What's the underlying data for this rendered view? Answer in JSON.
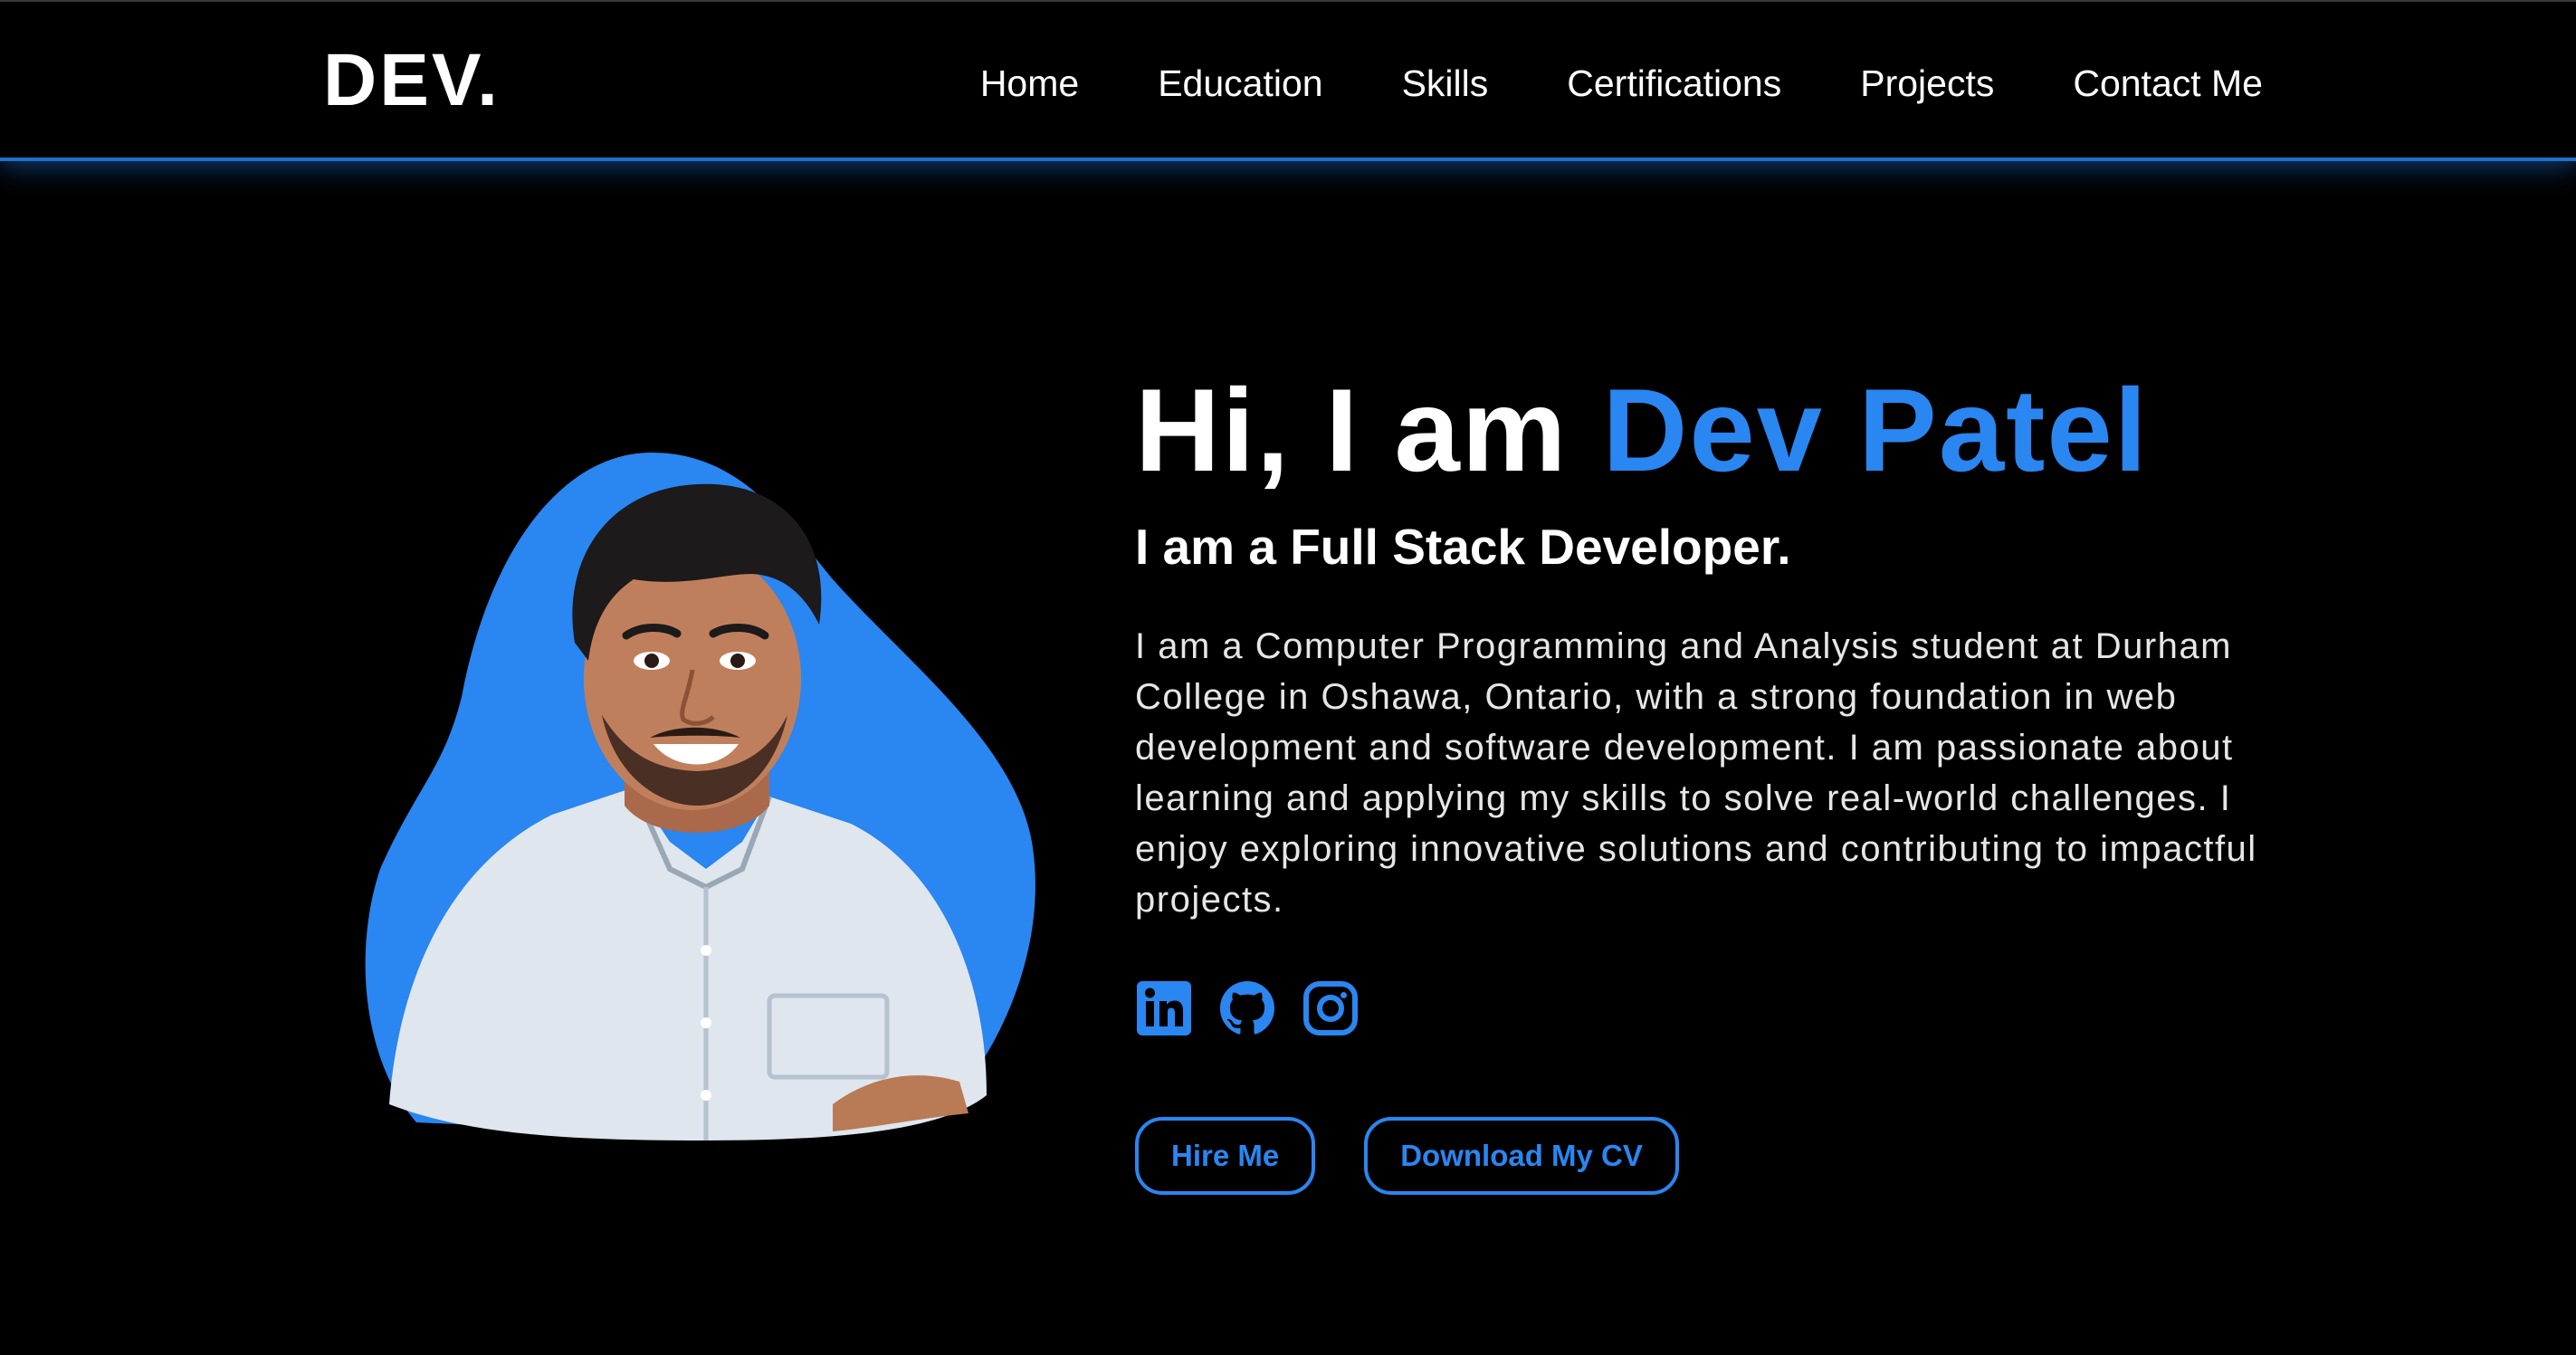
{
  "header": {
    "logo": "DEV.",
    "nav": [
      {
        "label": "Home"
      },
      {
        "label": "Education"
      },
      {
        "label": "Skills"
      },
      {
        "label": "Certifications"
      },
      {
        "label": "Projects"
      },
      {
        "label": "Contact Me"
      }
    ]
  },
  "hero": {
    "greeting": "Hi, I am ",
    "name": "Dev Patel",
    "subtitle": "I am a Full Stack Developer.",
    "bio": "I am a Computer Programming and Analysis student at Durham College in Oshawa, Ontario, with a strong foundation in web development and software development. I am passionate about learning and applying my skills to solve real-world challenges. I enjoy exploring innovative solutions and contributing to impactful projects.",
    "socials": [
      {
        "icon": "linkedin-icon"
      },
      {
        "icon": "github-icon"
      },
      {
        "icon": "instagram-icon"
      }
    ],
    "buttons": {
      "hire": "Hire Me",
      "cv": "Download My CV"
    }
  },
  "colors": {
    "background": "#000000",
    "accent": "#2a86f0",
    "text": "#ffffff"
  }
}
